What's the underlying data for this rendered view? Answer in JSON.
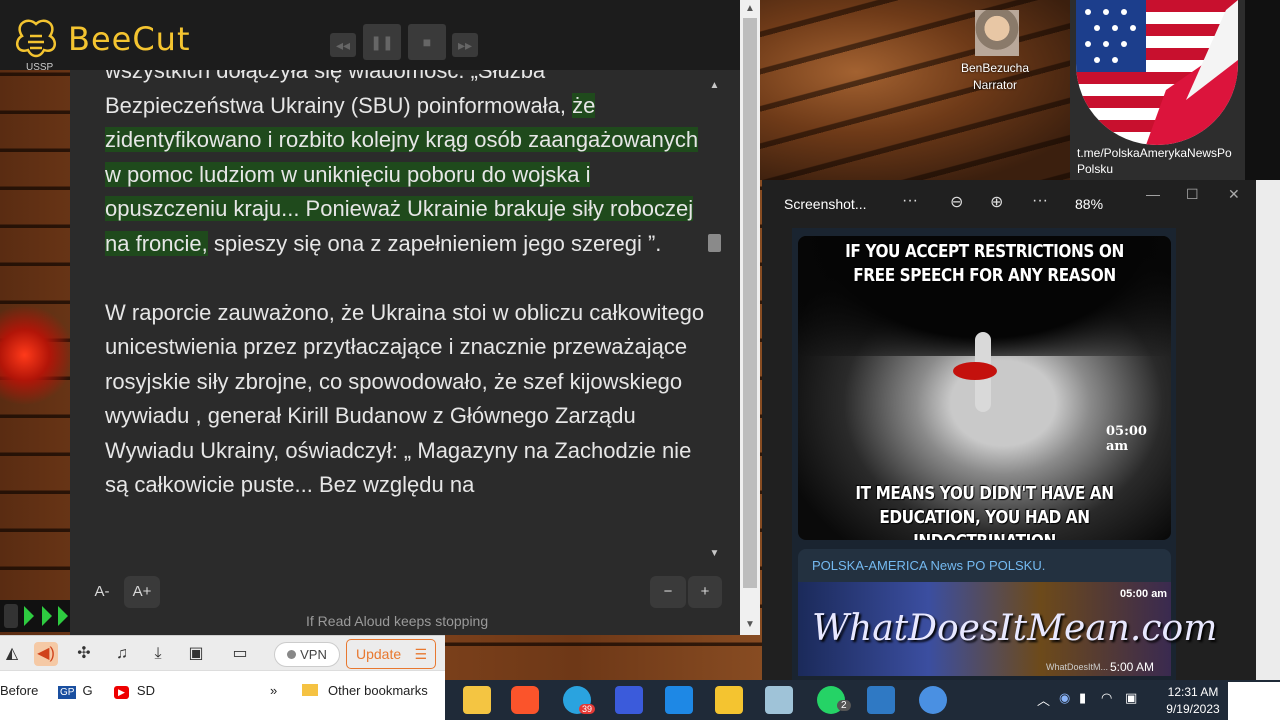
{
  "app": {
    "name": "BeeCut",
    "side_label": "USSP"
  },
  "reader": {
    "paragraph1": {
      "before": "wszystkich dołączyła się wiadomość: „Służba Bezpieczeństwa Ukrainy (SBU) poinformowała, ",
      "highlight": "że zidentyfikowano i rozbito kolejny krąg osób zaangażowanych w pomoc ludziom w uniknięciu poboru do wojska i opuszczeniu kraju... Ponieważ Ukrainie brakuje siły roboczej na froncie,",
      "after": " spieszy się ona z zapełnieniem jego szeregi ”."
    },
    "paragraph2": "W raporcie zauważono, że Ukraina stoi w obliczu całkowitego unicestwienia przez przytłaczające i znacznie przeważające rosyjskie siły zbrojne, co spowodowało, że szef kijowskiego wywiadu , generał Kirill Budanow z Głównego Zarządu Wywiadu Ukrainy, oświadczył: „ Magazyny na Zachodzie nie są całkowicie puste... Bez względu na",
    "font_decrease": "A-",
    "font_increase": "A+",
    "speed_decrease": "−",
    "speed_increase": "+",
    "note": "If Read Aloud keeps stopping"
  },
  "browser": {
    "vpn_label": "VPN",
    "update_label": "Update",
    "bookmarks": {
      "before": "Before",
      "gp": "G",
      "yt": "SD",
      "more": "»",
      "other": "Other bookmarks"
    }
  },
  "overlay": {
    "narrator_name": "BenBezucha",
    "narrator_role": "Narrator",
    "channel_link": "t.me/PolskaAmerykaNewsPo Polsku"
  },
  "viewer": {
    "title": "Screenshot...",
    "zoom": "88%",
    "meme_top": "IF YOU ACCEPT RESTRICTIONS ON FREE SPEECH FOR ANY REASON",
    "meme_bottom": "IT MEANS YOU DIDN'T HAVE AN EDUCATION, YOU HAD AN INDOCTRINATION",
    "meme_time": "05:00 am",
    "channel_name": "POLSKA-AMERICA News PO POLSKU.",
    "wdim_title": "WhatDoesItMean.com",
    "wdim_time1": "05:00 am",
    "wdim_time2": "5:00 AM",
    "wdim_site": "WhatDoesItM..."
  },
  "taskbar": {
    "time": "12:31 AM",
    "date": "9/19/2023",
    "telegram_badge": "39",
    "whatsapp_badge": "2"
  },
  "colors": {
    "highlight": "#1f4a1c",
    "beecut_gold": "#f4c430",
    "update_orange": "#e8782f",
    "telegram_link": "#74b9f0"
  }
}
